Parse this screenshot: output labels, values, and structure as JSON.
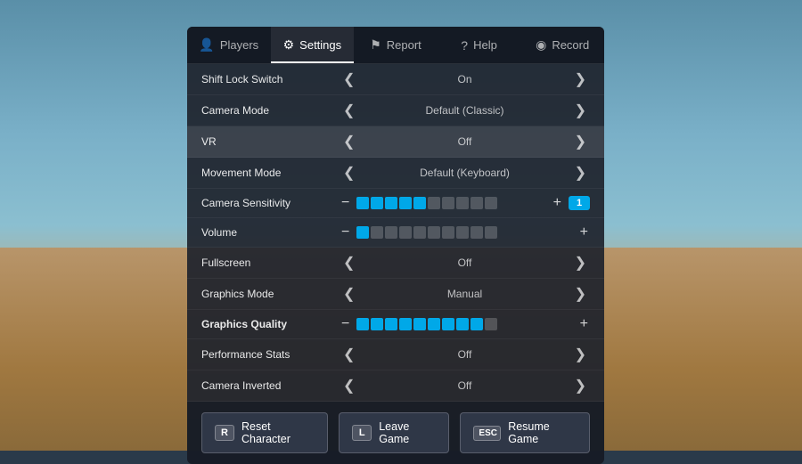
{
  "background": {
    "description": "Roblox game scene background"
  },
  "tabs": [
    {
      "id": "players",
      "label": "Players",
      "icon": "👤",
      "active": false
    },
    {
      "id": "settings",
      "label": "Settings",
      "icon": "⚙",
      "active": true
    },
    {
      "id": "report",
      "label": "Report",
      "icon": "⚑",
      "active": false
    },
    {
      "id": "help",
      "label": "Help",
      "icon": "?",
      "active": false
    },
    {
      "id": "record",
      "label": "Record",
      "icon": "◉",
      "active": false
    }
  ],
  "settings": [
    {
      "label": "Shift Lock Switch",
      "value": "On",
      "type": "toggle",
      "bold": false
    },
    {
      "label": "Camera Mode",
      "value": "Default (Classic)",
      "type": "toggle",
      "bold": false
    },
    {
      "label": "VR",
      "value": "Off",
      "type": "toggle",
      "bold": false,
      "highlighted": true
    },
    {
      "label": "Movement Mode",
      "value": "Default (Keyboard)",
      "type": "toggle",
      "bold": false
    },
    {
      "label": "Camera Sensitivity",
      "value": "",
      "type": "slider",
      "filled": 5,
      "total": 10,
      "badge": "1",
      "bold": false
    },
    {
      "label": "Volume",
      "value": "",
      "type": "slider-short",
      "filled": 1,
      "total": 10,
      "bold": false
    },
    {
      "label": "Fullscreen",
      "value": "Off",
      "type": "toggle",
      "bold": false
    },
    {
      "label": "Graphics Mode",
      "value": "Manual",
      "type": "toggle",
      "bold": false
    },
    {
      "label": "Graphics Quality",
      "value": "",
      "type": "slider",
      "filled": 9,
      "total": 10,
      "bold": true
    },
    {
      "label": "Performance Stats",
      "value": "Off",
      "type": "toggle",
      "bold": false
    },
    {
      "label": "Camera Inverted",
      "value": "Off",
      "type": "toggle",
      "bold": false
    }
  ],
  "footer": {
    "buttons": [
      {
        "key": "R",
        "label": "Reset Character"
      },
      {
        "key": "L",
        "label": "Leave Game"
      },
      {
        "key": "ESC",
        "label": "Resume Game"
      }
    ]
  }
}
